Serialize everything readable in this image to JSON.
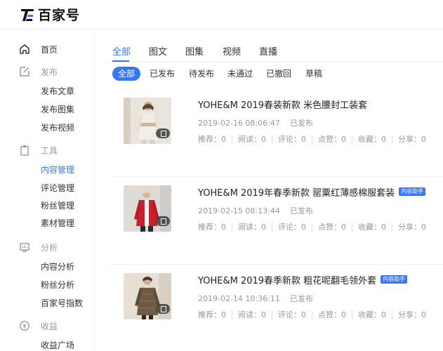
{
  "header": {
    "logo_text": "百家号",
    "logo_icon": "baijiahao-logo-icon"
  },
  "sidebar": {
    "home": {
      "label": "首页",
      "icon": "home-icon"
    },
    "publish": {
      "label": "发布",
      "icon": "edit-icon",
      "items": [
        "发布文章",
        "发布图集",
        "发布视频"
      ]
    },
    "tools": {
      "label": "工具",
      "icon": "clipboard-icon",
      "items": [
        "内容管理",
        "评论管理",
        "粉丝管理",
        "素材管理"
      ],
      "active_index": 0
    },
    "analysis": {
      "label": "分析",
      "icon": "chart-icon",
      "items": [
        "内容分析",
        "粉丝分析",
        "百家号指数"
      ]
    },
    "income": {
      "label": "收益",
      "icon": "coin-icon",
      "items": [
        "收益广场"
      ]
    }
  },
  "main": {
    "tabs": [
      "全部",
      "图文",
      "图集",
      "视频",
      "直播"
    ],
    "active_tab": 0,
    "filters": [
      "全部",
      "已发布",
      "待发布",
      "未通过",
      "已撤回",
      "草稿"
    ],
    "active_filter": 0,
    "articles": [
      {
        "title": "YOHE&M 2019春装新款 米色腰封工装套",
        "helper_tag": "",
        "date": "2019-02-16 08:06:47",
        "status": "已发布",
        "stats": [
          "推荐：0",
          "阅读：0",
          "评论：0",
          "点赞：0",
          "收藏：0",
          "分享：0"
        ],
        "thumb_colors": {
          "bg": "#e9e4dc",
          "coat": "#f1ede5",
          "accent": "#c9b9a0"
        }
      },
      {
        "title": "YOHE&M 2019年春季新款 罂粟红薄感棉服套装",
        "helper_tag": "内容助手",
        "date": "2019-02-15 08:13:44",
        "status": "已发布",
        "stats": [
          "推荐：0",
          "阅读：0",
          "评论：0",
          "点赞：0",
          "收藏：0",
          "分享：0"
        ],
        "thumb_colors": {
          "bg": "#dedad6",
          "coat": "#c8202e",
          "accent": "#f3f3f3"
        }
      },
      {
        "title": "YOHE&M 2019春季新款 粗花呢翻毛领外套",
        "helper_tag": "内容助手",
        "date": "2019-02-14 10:36:11",
        "status": "已发布",
        "stats": [
          "推荐：0",
          "阅读：0",
          "评论：0",
          "点赞：0",
          "收藏：0",
          "分享：0"
        ],
        "thumb_colors": {
          "bg": "#e6e0d4",
          "coat": "#6e5a44",
          "accent": "#d9cdb9"
        }
      }
    ]
  },
  "colors": {
    "accent": "#3a76f0",
    "muted": "#999999",
    "divider": "#eeeeee"
  }
}
